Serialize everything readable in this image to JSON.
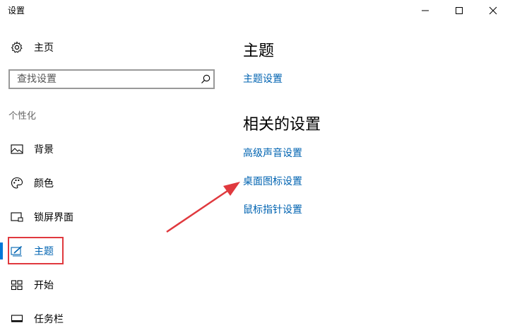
{
  "window": {
    "title": "设置",
    "controls": [
      "minimize-icon",
      "maximize-icon",
      "close-icon"
    ]
  },
  "sidebar": {
    "home_label": "主页",
    "search_placeholder": "查找设置",
    "section_label": "个性化",
    "items": [
      {
        "label": "背景",
        "icon": "picture-icon"
      },
      {
        "label": "颜色",
        "icon": "palette-icon"
      },
      {
        "label": "锁屏界面",
        "icon": "lock-screen-icon"
      },
      {
        "label": "主题",
        "icon": "theme-icon",
        "selected": true
      },
      {
        "label": "开始",
        "icon": "start-icon"
      },
      {
        "label": "任务栏",
        "icon": "taskbar-icon"
      }
    ]
  },
  "main": {
    "title": "主题",
    "theme_settings_link": "主题设置",
    "related_title": "相关的设置",
    "related_links": [
      "高级声音设置",
      "桌面图标设置",
      "鼠标指针设置"
    ]
  },
  "colors": {
    "accent": "#0078d7",
    "link": "#0063b1",
    "annotation": "#e0393e"
  }
}
